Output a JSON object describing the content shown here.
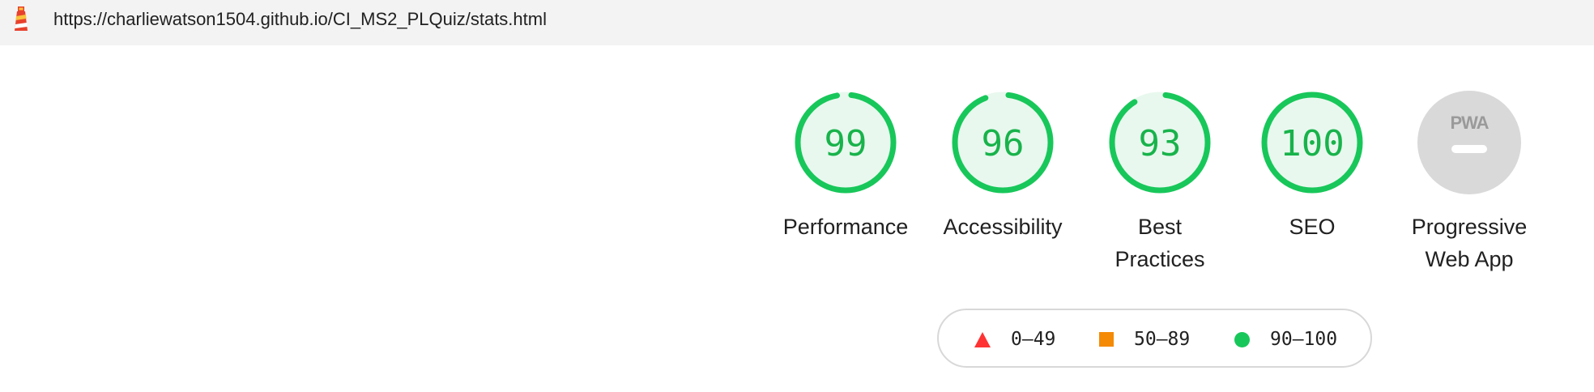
{
  "browser": {
    "url": "https://charliewatson1504.github.io/CI_MS2_PLQuiz/stats.html",
    "icon": "lighthouse-icon"
  },
  "gauges": [
    {
      "name": "performance",
      "label_lines": [
        "Performance"
      ],
      "score": 99,
      "display": "99",
      "color": "#18c75a",
      "fill": "#e8f8ee"
    },
    {
      "name": "accessibility",
      "label_lines": [
        "Accessibility"
      ],
      "score": 96,
      "display": "96",
      "color": "#18c75a",
      "fill": "#e8f8ee"
    },
    {
      "name": "best-practices",
      "label_lines": [
        "Best",
        "Practices"
      ],
      "score": 93,
      "display": "93",
      "color": "#18c75a",
      "fill": "#e8f8ee"
    },
    {
      "name": "seo",
      "label_lines": [
        "SEO"
      ],
      "score": 100,
      "display": "100",
      "color": "#18c75a",
      "fill": "#e8f8ee"
    }
  ],
  "pwa": {
    "label_lines": [
      "Progressive",
      "Web App"
    ],
    "badge_text": "PWA",
    "icon": "pwa-badge-icon",
    "color": "#d9d9d9"
  },
  "legend": [
    {
      "shape": "triangle",
      "range": "0–49",
      "color": "#ff3333"
    },
    {
      "shape": "square",
      "range": "50–89",
      "color": "#f58a07"
    },
    {
      "shape": "circle",
      "range": "90–100",
      "color": "#18c75a"
    }
  ]
}
